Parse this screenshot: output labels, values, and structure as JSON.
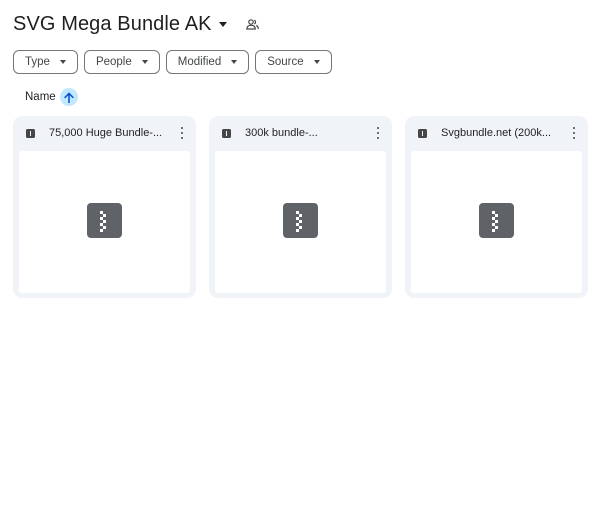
{
  "header": {
    "title": "SVG Mega Bundle AK",
    "title_menu_icon": "caret-down-icon",
    "shared_icon": "people-icon"
  },
  "filters": [
    {
      "label": "Type"
    },
    {
      "label": "People"
    },
    {
      "label": "Modified"
    },
    {
      "label": "Source"
    }
  ],
  "sort": {
    "label": "Name",
    "direction": "ascending",
    "icon": "arrow-up-icon"
  },
  "files": [
    {
      "name": "75,000 Huge Bundle-...",
      "type_icon": "zip-file-icon",
      "thumbnail_icon": "zip-archive-icon"
    },
    {
      "name": "300k bundle-...",
      "type_icon": "zip-file-icon",
      "thumbnail_icon": "zip-archive-icon"
    },
    {
      "name": "Svgbundle.net (200k...",
      "type_icon": "zip-file-icon",
      "thumbnail_icon": "zip-archive-icon"
    }
  ],
  "colors": {
    "card_background": "#f0f4f9",
    "sort_button_background": "#c2e7ff",
    "icon_gray": "#5f6368",
    "chip_border": "#747775"
  }
}
